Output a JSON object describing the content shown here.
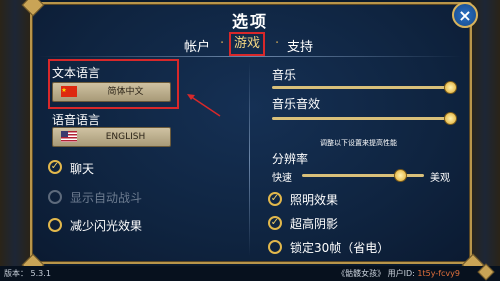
{
  "dialog": {
    "title": "选项",
    "close_glyph": "×"
  },
  "tabs": [
    {
      "label": "帐户",
      "active": false
    },
    {
      "label": "游戏",
      "active": true
    },
    {
      "label": "支持",
      "active": false
    }
  ],
  "tab_separator": "·",
  "left": {
    "text_language_label": "文本语言",
    "text_language_value": "简体中文",
    "voice_language_label": "语音语言",
    "voice_language_value": "ENGLISH",
    "options": [
      {
        "label": "聊天",
        "checked": true,
        "enabled": true
      },
      {
        "label": "显示自动战斗",
        "checked": false,
        "enabled": false
      },
      {
        "label": "减少闪光效果",
        "checked": false,
        "enabled": true
      }
    ]
  },
  "right": {
    "music_label": "音乐",
    "music_level": 1.0,
    "sfx_label": "音乐音效",
    "sfx_level": 1.0,
    "perf_hint": "调整以下设置来提高性能",
    "resolution_label": "分辨率",
    "resolution_min": "快速",
    "resolution_max": "美观",
    "resolution_level": 0.8,
    "options": [
      {
        "label": "照明效果",
        "checked": true
      },
      {
        "label": "超高阴影",
        "checked": true
      },
      {
        "label": "锁定30帧（省电）",
        "checked": false
      }
    ]
  },
  "footer": {
    "version_label": "版本：",
    "version_value": "5.3.1",
    "game_name": "《骷髅女孩》",
    "user_id_label": "用户ID:",
    "user_id_value": "1t5y-fcvy9"
  },
  "colors": {
    "accent_gold": "#e2b84c",
    "highlight_red": "#d8282a",
    "panel_blue": "#0f2440"
  }
}
